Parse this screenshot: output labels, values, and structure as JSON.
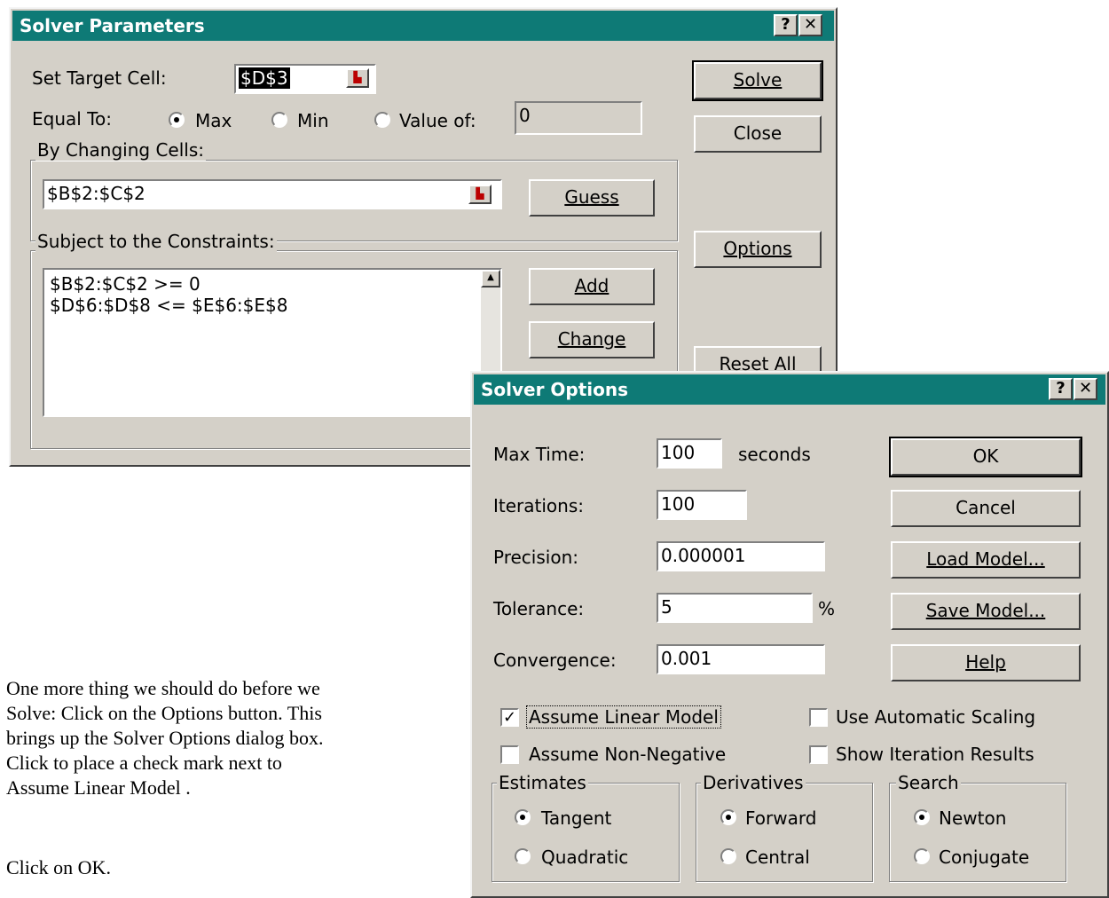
{
  "solver_parameters": {
    "title": "Solver Parameters",
    "help_button": "?",
    "close_button": "✕",
    "set_target_cell_label": "Set Target Cell:",
    "target_cell_value": "$D$3",
    "equal_to_label": "Equal To:",
    "radio_max": "Max",
    "radio_min": "Min",
    "radio_value_of": "Value of:",
    "value_of_input": "0",
    "by_changing_cells_label": "By Changing Cells:",
    "changing_cells_value": "$B$2:$C$2",
    "guess_button": "Guess",
    "constraints_label": "Subject to the Constraints:",
    "constraints": [
      "$B$2:$C$2 >= 0",
      "$D$6:$D$8 <= $E$6:$E$8"
    ],
    "add_button": "Add",
    "change_button": "Change",
    "solve_button": "Solve",
    "close_btn_label": "Close",
    "options_button": "Options",
    "reset_all_button": "Reset All"
  },
  "solver_options": {
    "title": "Solver Options",
    "help_button": "?",
    "close_button": "✕",
    "max_time_label": "Max Time:",
    "max_time_value": "100",
    "seconds_label": "seconds",
    "iterations_label": "Iterations:",
    "iterations_value": "100",
    "precision_label": "Precision:",
    "precision_value": "0.000001",
    "tolerance_label": "Tolerance:",
    "tolerance_value": "5",
    "percent_label": "%",
    "convergence_label": "Convergence:",
    "convergence_value": "0.001",
    "ok_button": "OK",
    "cancel_button": "Cancel",
    "load_model_button": "Load Model...",
    "save_model_button": "Save Model...",
    "help_btn_label": "Help",
    "assume_linear_model": "Assume Linear Model",
    "use_automatic_scaling": "Use Automatic Scaling",
    "assume_non_negative": "Assume Non-Negative",
    "show_iteration_results": "Show Iteration Results",
    "estimates_label": "Estimates",
    "tangent": "Tangent",
    "quadratic": "Quadratic",
    "derivatives_label": "Derivatives",
    "forward": "Forward",
    "central": "Central",
    "search_label": "Search",
    "newton": "Newton",
    "conjugate": "Conjugate"
  },
  "instructions": {
    "paragraph1": [
      "One more thing we should do before we",
      "Solve:  Click on the Options button.  This",
      "brings up the Solver Options dialog box.",
      "Click to place a check mark next to",
      "Assume Linear Model ."
    ],
    "paragraph2": "Click on OK."
  }
}
